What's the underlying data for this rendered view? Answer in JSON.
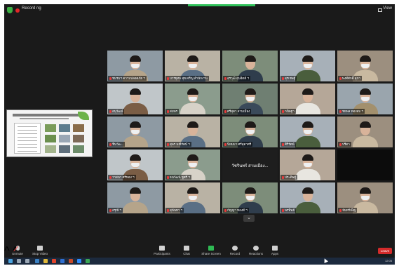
{
  "topbar": {
    "recording_label": "Record ng",
    "view_label": "View"
  },
  "colors": {
    "window_bg": "#1a1a1a",
    "accent_green": "#30c25a",
    "leave_red": "#d42b2b",
    "active_speaker": "#c8d23c",
    "taskbar": "#1c2a3e"
  },
  "participants": [
    {
      "name": "ชมรมฯ ความปลอดภัย ฯ"
    },
    {
      "name": "บวรยุทธ สุขเจริญ สำนักงาน"
    },
    {
      "name": "สุรวุฒิ อุ่นจิตต์ ฯ"
    },
    {
      "name": "สุรเชษฐ์"
    },
    {
      "name": "พงศ์ศักดิ์ สุภา"
    },
    {
      "name": "อนุวัฒน์"
    },
    {
      "name": "สมพร"
    },
    {
      "name": "ศรีสุดา สามเมือง"
    },
    {
      "name": "กนิษฐา"
    },
    {
      "name": "ชยพล ทองสม ฯ"
    },
    {
      "name": "ชินวัฒ..."
    },
    {
      "name": "สุพร มณีรัตน์ ฯ"
    },
    {
      "name": "นิยมมา ศรีสุดาศรี"
    },
    {
      "name": "ศิริรัตน์"
    },
    {
      "name": "ปรีดา"
    },
    {
      "name": "วาสนา ศรีทอง ฯ"
    },
    {
      "name": "ธนวัฒน์ ชูศรี ฯ"
    },
    {
      "name": "วัชรินทร์ สามเมือง...",
      "video_off": true
    },
    {
      "name": "ประดิษฐ์"
    },
    {
      "name": ""
    },
    {
      "name": "อรุณี ฯ"
    },
    {
      "name": "สุนันทา ฯ"
    },
    {
      "name": "กัญญา ทองดี ฯ"
    },
    {
      "name": "พรทิพย์"
    },
    {
      "name": "จันทร์เพ็ญ"
    }
  ],
  "toolbar": {
    "unmute": "Unmute",
    "stop_video": "Stop Video",
    "participants": "Participants",
    "participants_count": "30",
    "chat": "Chat",
    "share_screen": "Share Screen",
    "record": "Record",
    "reactions": "Reactions",
    "apps": "Apps",
    "leave": "Leave"
  },
  "taskbar": {
    "time": "12:05"
  },
  "pager": {
    "icon": "chevron-down-icon",
    "glyph": "⌄"
  }
}
